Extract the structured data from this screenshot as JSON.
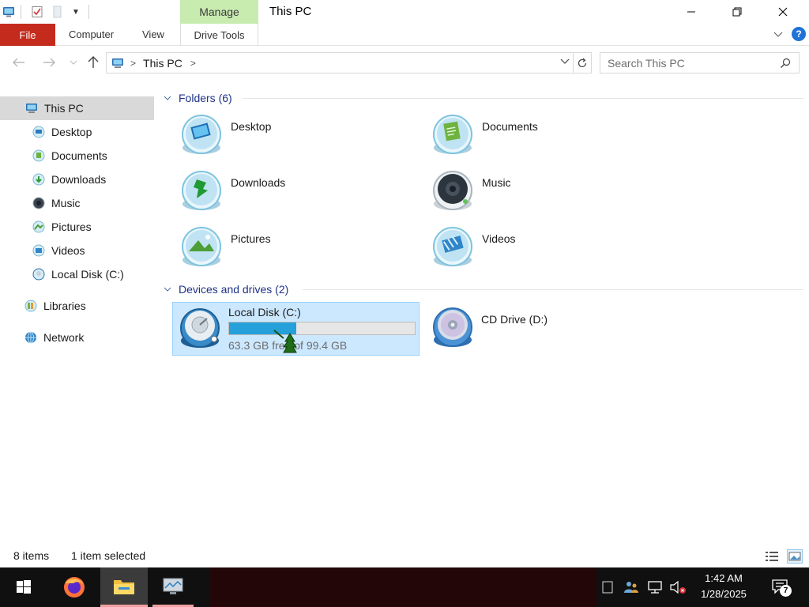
{
  "window": {
    "title": "This PC",
    "manage_tab": "Manage",
    "ribbon_tabs": {
      "file": "File",
      "computer": "Computer",
      "view": "View",
      "drive_tools": "Drive Tools"
    }
  },
  "address": {
    "breadcrumb": "This PC",
    "search_placeholder": "Search This PC"
  },
  "sidebar": {
    "items": [
      {
        "label": "This PC",
        "icon": "this-pc-icon"
      },
      {
        "label": "Desktop",
        "icon": "desktop-icon"
      },
      {
        "label": "Documents",
        "icon": "documents-icon"
      },
      {
        "label": "Downloads",
        "icon": "downloads-icon"
      },
      {
        "label": "Music",
        "icon": "music-icon"
      },
      {
        "label": "Pictures",
        "icon": "pictures-icon"
      },
      {
        "label": "Videos",
        "icon": "videos-icon"
      },
      {
        "label": "Local Disk (C:)",
        "icon": "drive-icon"
      },
      {
        "label": "Libraries",
        "icon": "libraries-icon"
      },
      {
        "label": "Network",
        "icon": "network-icon"
      }
    ]
  },
  "folders": {
    "header": "Folders (6)",
    "items": [
      {
        "label": "Desktop",
        "icon": "desktop-icon"
      },
      {
        "label": "Documents",
        "icon": "documents-icon"
      },
      {
        "label": "Downloads",
        "icon": "downloads-icon"
      },
      {
        "label": "Music",
        "icon": "music-icon"
      },
      {
        "label": "Pictures",
        "icon": "pictures-icon"
      },
      {
        "label": "Videos",
        "icon": "videos-icon"
      }
    ]
  },
  "devices": {
    "header": "Devices and drives (2)",
    "local_disk": {
      "name": "Local Disk (C:)",
      "free_text": "63.3 GB free of 99.4 GB",
      "used_fraction": 0.363,
      "selected": true
    },
    "cd_drive": {
      "name": "CD Drive (D:)"
    }
  },
  "status": {
    "items_count": "8 items",
    "selected": "1 item selected"
  },
  "taskbar": {
    "time": "1:42 AM",
    "date": "1/28/2025",
    "notification_count": "7"
  },
  "colors": {
    "file_tab": "#c42b1c",
    "manage_tab": "#c8ebb0",
    "selection": "#cce8ff",
    "progress": "#26a0da",
    "group_header": "#1e3287"
  }
}
